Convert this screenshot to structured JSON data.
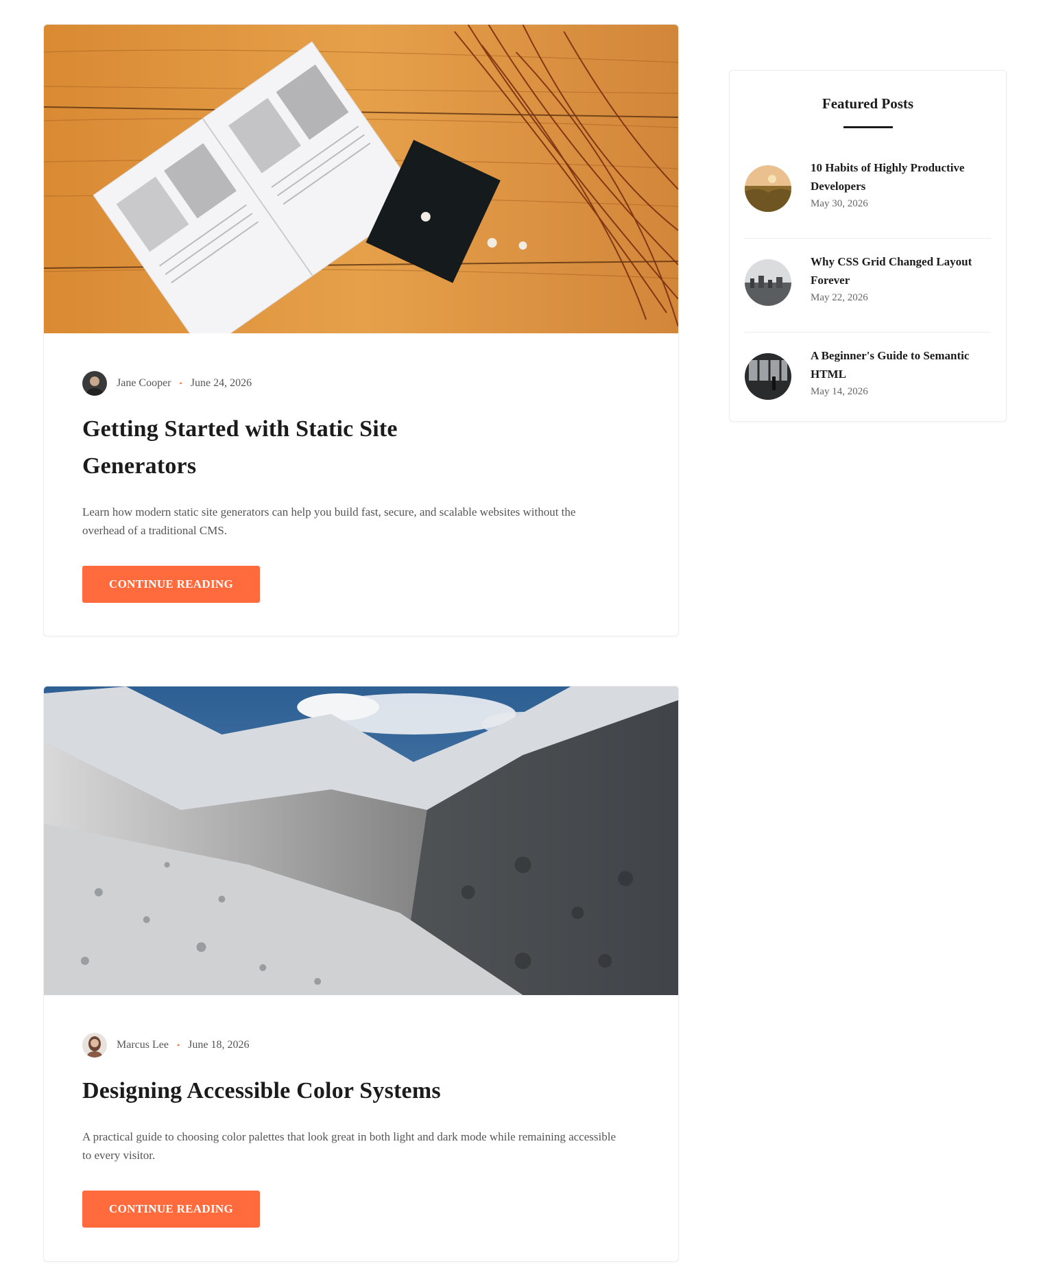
{
  "posts": [
    {
      "image_label": "open book on wooden table with dried flowers",
      "author": "Jane Cooper",
      "date": "June 24, 2026",
      "title": "Getting Started with Static Site Generators",
      "excerpt": "Learn how modern static site generators can help you build fast, secure, and scalable websites without the overhead of a traditional CMS.",
      "button_label": "CONTINUE READING"
    },
    {
      "image_label": "snowy mountain valley",
      "author": "Marcus Lee",
      "date": "June 18, 2026",
      "title": "Designing Accessible Color Systems",
      "excerpt": "A practical guide to choosing color palettes that look great in both light and dark mode while remaining accessible to every visitor.",
      "button_label": "CONTINUE READING"
    }
  ],
  "sidebar": {
    "title": "Featured Posts",
    "items": [
      {
        "title": "10 Habits of Highly Productive Developers",
        "date": "May 30, 2026"
      },
      {
        "title": "Why CSS Grid Changed Layout Forever",
        "date": "May 22, 2026"
      },
      {
        "title": "A Beginner's Guide to Semantic HTML",
        "date": "May 14, 2026"
      }
    ]
  },
  "colors": {
    "accent": "#ff6b3d",
    "text": "#1b1b1b",
    "muted": "#555555",
    "border": "#ececec"
  }
}
